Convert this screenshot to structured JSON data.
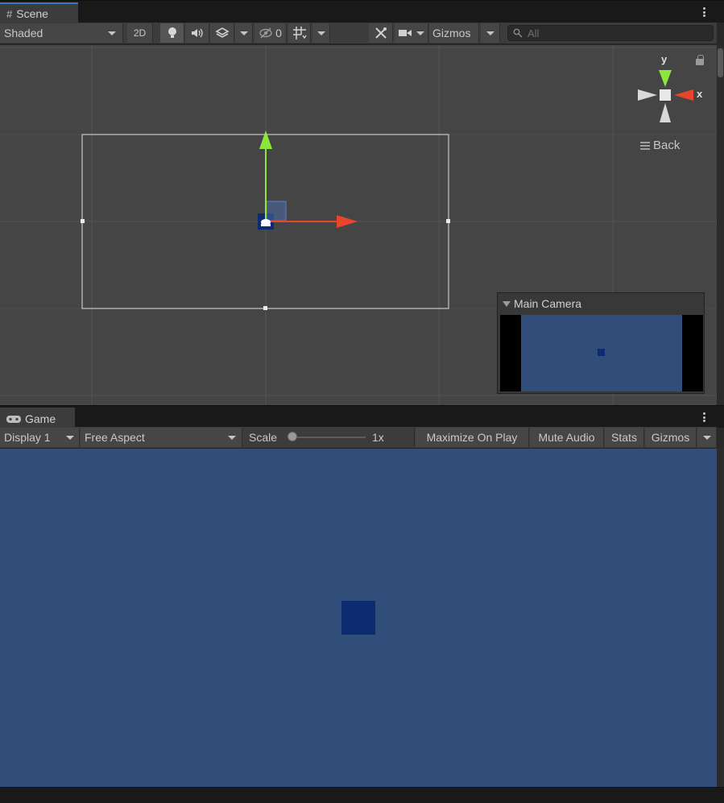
{
  "scene_panel": {
    "tab_label": "Scene",
    "shading_mode": "Shaded",
    "toggle_2d": "2D",
    "hidden_count": "0",
    "gizmos_label": "Gizmos",
    "search_placeholder": "All",
    "orientation_label": "Back",
    "axis_y": "y",
    "axis_x": "x",
    "camera_preview_title": "Main Camera"
  },
  "game_panel": {
    "tab_label": "Game",
    "display": "Display 1",
    "aspect": "Free Aspect",
    "scale_label": "Scale",
    "scale_value": "1x",
    "scale_fraction": 0,
    "maximize_on_play": "Maximize On Play",
    "mute_audio": "Mute Audio",
    "stats": "Stats",
    "gizmos_label": "Gizmos"
  },
  "colors": {
    "editor_dark": "#191919",
    "toolbar": "#3c3c3c",
    "scene_background": "#454545",
    "game_background": "#314d79",
    "sprite": "#0d2b73",
    "tab_accent": "#3a79bb",
    "gizmo_x": "#e8462a",
    "gizmo_y": "#8ce63c"
  },
  "icons": {
    "scene_tab": "hash-grid-icon",
    "game_tab": "gamepad-icon",
    "lighting": "lightbulb-icon",
    "audio": "speaker-icon",
    "effects": "layers-icon",
    "visibility": "eye-slash-icon",
    "grid": "grid-snap-icon",
    "tools": "wrench-icon",
    "camera": "video-camera-icon",
    "search": "search-icon",
    "menu": "kebab-menu-icon",
    "lock": "lock-icon"
  }
}
